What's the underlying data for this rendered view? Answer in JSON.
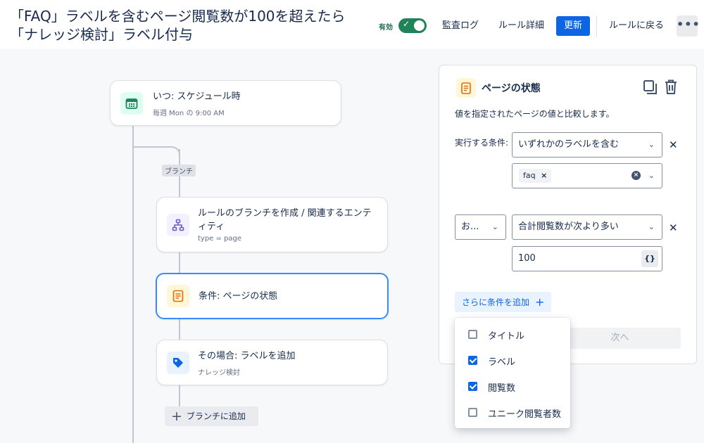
{
  "header": {
    "title": "「FAQ」ラベルを含むページ閲覧数が100を超えたら「ナレッジ検討」ラベル付与",
    "status_label": "有効",
    "toggle_check": "✓",
    "audit_log": "監査ログ",
    "rule_details": "ルール詳細",
    "update": "更新",
    "back_to_rules": "ルールに戻る",
    "more": "•••"
  },
  "flow": {
    "trigger": {
      "title": "いつ: スケジュール時",
      "subtitle": "毎週 Mon の 9:00 AM"
    },
    "branch_tag": "ブランチ",
    "branch": {
      "title": "ルールのブランチを作成 / 関連するエンティティ",
      "subtitle": "type = page"
    },
    "condition": {
      "title": "条件: ページの状態"
    },
    "action": {
      "title": "その場合: ラベルを追加",
      "subtitle": "ナレッジ検討"
    },
    "add_branch": "ブランチに追加",
    "add_branch_icon": "+"
  },
  "panel": {
    "title": "ページの状態",
    "description": "値を指定されたページの値と比較します。",
    "condition_label": "実行する条件:",
    "condition_select": "いずれかのラベルを含む",
    "label_chip": "faq",
    "chip_remove": "×",
    "clear_icon": "×",
    "operator_select": "お...",
    "compare_select": "合計閲覧数が次より多い",
    "value": "100",
    "value_brace": "{}",
    "remove_icon": "✕",
    "chevron": "⌄",
    "add_condition": "さらに条件を追加",
    "add_condition_icon": "+",
    "next": "次へ"
  },
  "dropdown": {
    "items": [
      {
        "label": "タイトル",
        "checked": false
      },
      {
        "label": "ラベル",
        "checked": true
      },
      {
        "label": "閲覧数",
        "checked": true
      },
      {
        "label": "ユニーク閲覧者数",
        "checked": false
      }
    ]
  },
  "colors": {
    "primary": "#0c66e4",
    "toggle_on": "#1f845a",
    "selected_border": "#388bff",
    "trigger_icon": "#1f845a",
    "branch_icon": "#6e5dc6",
    "condition_icon": "#e56910",
    "action_icon": "#0c66e4"
  },
  "icons": {
    "trigger": "calendar-icon",
    "branch": "hierarchy-icon",
    "condition": "document-icon",
    "action": "tag-icon",
    "panel": "document-icon",
    "copy": "copy-icon",
    "delete": "trash-icon"
  }
}
